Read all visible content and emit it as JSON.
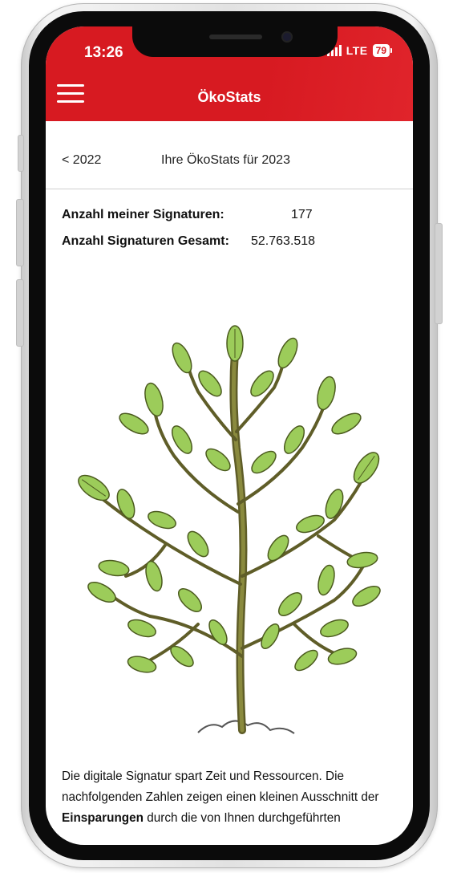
{
  "status_bar": {
    "time": "13:26",
    "network": "LTE",
    "battery": "79"
  },
  "header": {
    "title": "ÖkoStats",
    "menu_icon": "hamburger-menu-icon"
  },
  "year_nav": {
    "prev_label": "< 2022",
    "title": "Ihre ÖkoStats für 2023"
  },
  "stats": {
    "my_signatures_label": "Anzahl meiner Signaturen:",
    "my_signatures_value": "177",
    "total_signatures_label": "Anzahl Signaturen Gesamt:",
    "total_signatures_value": "52.763.518"
  },
  "illustration": {
    "icon": "tree-illustration"
  },
  "description": {
    "part1": "Die digitale Signatur spart Zeit und Ressourcen. Die nachfolgenden Zahlen zeigen einen kleinen Ausschnitt der ",
    "bold": "Einsparungen",
    "part2": " durch die von Ihnen durchgeführten"
  },
  "colors": {
    "accent": "#d71a21",
    "leaf": "#9ccc5a",
    "trunk": "#6b6a2e"
  }
}
